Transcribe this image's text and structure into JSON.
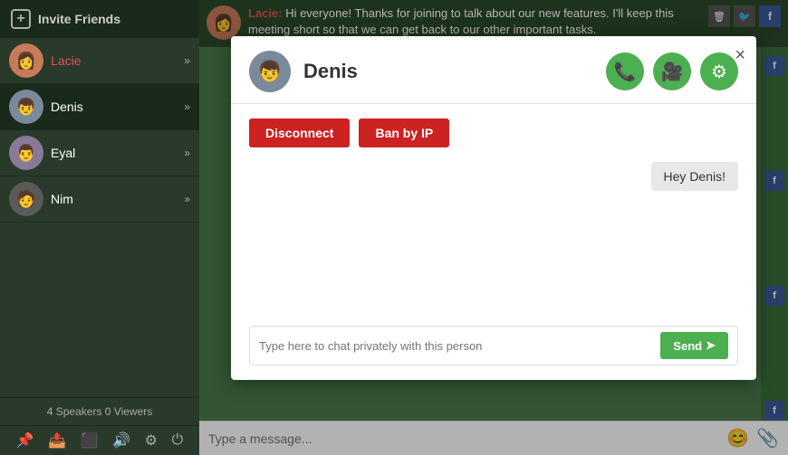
{
  "sidebar": {
    "header": {
      "label": "Invite Friends",
      "plus_icon": "+"
    },
    "items": [
      {
        "id": "lacie",
        "name": "Lacie",
        "name_class": "red",
        "active": false,
        "avatar_text": "👩"
      },
      {
        "id": "denis",
        "name": "Denis",
        "name_class": "",
        "active": true,
        "avatar_text": "👦"
      },
      {
        "id": "eyal",
        "name": "Eyal",
        "name_class": "",
        "active": false,
        "avatar_text": "👨"
      },
      {
        "id": "nim",
        "name": "Nim",
        "name_class": "",
        "active": false,
        "avatar_text": "🧑"
      }
    ],
    "footer": "4 Speakers 0 Viewers",
    "action_icons": [
      "📌",
      "📤",
      "⬛",
      "🔊",
      "⚙",
      "⏻"
    ]
  },
  "top_bar": {
    "sender": "Lacie:",
    "message": " Hi everyone! Thanks for joining to talk about our new features. I'll keep this meeting short so that we can get back to our other important tasks.",
    "icons": [
      "🗑",
      "🐦",
      "f"
    ]
  },
  "modal": {
    "title": "Denis",
    "close_label": "×",
    "phone_icon": "📞",
    "video_icon": "🎥",
    "settings_icon": "⚙",
    "disconnect_label": "Disconnect",
    "ban_ip_label": "Ban by IP",
    "message": "Hey Denis!",
    "chat_placeholder": "Type here to chat privately with this person",
    "send_label": "Send",
    "send_icon": "➤"
  },
  "bottom_bar": {
    "placeholder": "Type a message...",
    "emoji_icon": "😊",
    "attach_icon": "📎"
  },
  "right_strip": {
    "f_badges": [
      "f",
      "f",
      "f",
      "f"
    ]
  }
}
